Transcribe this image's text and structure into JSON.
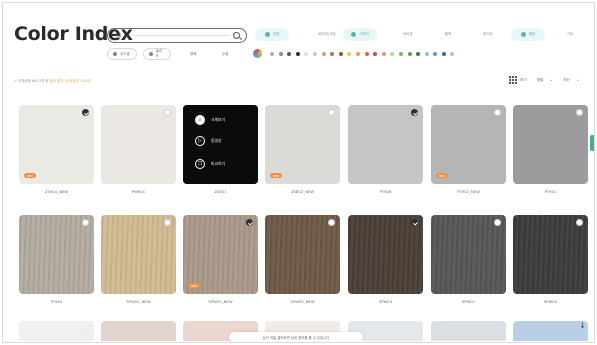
{
  "header": {
    "logo": "Color Index",
    "search": {
      "select_label": "전체",
      "chevron": "⌄"
    }
  },
  "filter_chips": [
    {
      "label": "전체",
      "active": true
    },
    {
      "label": "베이지/크림",
      "active": false
    },
    {
      "label": "그레이",
      "active": true
    },
    {
      "label": "브라운",
      "active": false
    },
    {
      "label": "블랙",
      "active": false
    },
    {
      "label": "화이트",
      "active": false
    },
    {
      "label": "패턴",
      "active": true
    },
    {
      "label": "기타",
      "active": false
    }
  ],
  "sub_chips": [
    {
      "label": "우드결"
    },
    {
      "label": "솔리드"
    },
    {
      "label": "광택"
    },
    {
      "label": "무광"
    }
  ],
  "color_swatches": [
    "#b0b0b0",
    "#8a8a8a",
    "#5a5a5a",
    "#2e2e2e",
    "#e8e0d4",
    "#d9c8b0",
    "#c8a580",
    "#b27a52",
    "#8a5a3a",
    "#e0c870",
    "#e8a040",
    "#e06040",
    "#c84a4a",
    "#e090a0",
    "#b8d890",
    "#7ab86a",
    "#5aa05a",
    "#3a7a4a",
    "#90c0e0",
    "#5a9ad0",
    "#3a6ab0",
    "#d0b0e0"
  ],
  "breadcrumb": {
    "prefix": "< 전체상품 6813개 중",
    "highlight": " 필터 결과 (검색결과 120개)"
  },
  "toolbar": {
    "view_label": "보기",
    "sort_label": "정렬",
    "sort_chevron": "⌄",
    "sort_value": "최신",
    "sort_value_chevron": "⌄"
  },
  "cards": [
    {
      "name": "ZS904_NEW",
      "badge": "NEW",
      "selected": true,
      "color": "#ebe9e4"
    },
    {
      "name": "PW901",
      "badge": "",
      "selected": false,
      "color": "#ebe8e3"
    },
    {
      "name": "ZS801",
      "badge": "",
      "selected": false,
      "color": "#0f0f0f",
      "overlay": true
    },
    {
      "name": "ZS802_NEW",
      "badge": "NEW",
      "selected": false,
      "color": "#dcdad6"
    },
    {
      "name": "PT908",
      "badge": "",
      "selected": true,
      "color": "#c4c6c4"
    },
    {
      "name": "PT902_NEW",
      "badge": "NEW",
      "selected": false,
      "color": "#b4b5b4"
    },
    {
      "name": "PT901",
      "badge": "",
      "selected": false,
      "color": "#9c9c9e"
    },
    {
      "name": "PT903",
      "badge": "",
      "selected": false,
      "color": "#b3aba1"
    },
    {
      "name": "SPW02_NEW",
      "badge": "",
      "selected": false,
      "color": "#d2bb93"
    },
    {
      "name": "SPW03_NEW",
      "badge": "NEW",
      "selected": true,
      "color": "#a9998a"
    },
    {
      "name": "SPW05_NEW",
      "badge": "",
      "selected": false,
      "color": "#6f5845"
    },
    {
      "name": "SPW04",
      "badge": "",
      "selected": true,
      "color": "#4a3f37"
    },
    {
      "name": "SPW01",
      "badge": "",
      "selected": false,
      "color": "#585654"
    },
    {
      "name": "SPW03",
      "badge": "",
      "selected": false,
      "color": "#3d3b39"
    }
  ],
  "overlay_menu": [
    {
      "icon": "magnifier",
      "label": "크게보기"
    },
    {
      "icon": "play",
      "label": "동영상"
    },
    {
      "icon": "copy",
      "label": "비교하기"
    }
  ],
  "peek_colors": [
    "#f0f0f0",
    "#e2d3ce",
    "#ecd6d0",
    "#f1ece8",
    "#e4e8ea",
    "#dadfe4",
    "#b8cfe6"
  ],
  "footer": {
    "hint": "상자 색을 클릭하면 상세 정보를 볼 수 있습니다",
    "dash": "--",
    "scroll_arrow": "↓"
  }
}
